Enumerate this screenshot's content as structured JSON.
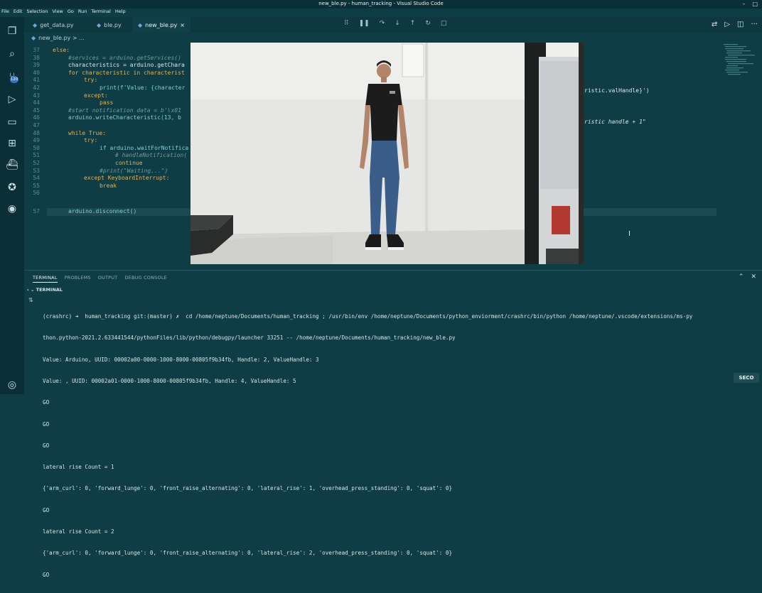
{
  "window": {
    "title": "new_ble.py - human_tracking - Visual Studio Code"
  },
  "menubar": [
    "File",
    "Edit",
    "Selection",
    "View",
    "Go",
    "Run",
    "Terminal",
    "Help"
  ],
  "tabs": [
    {
      "label": "get_data.py",
      "active": false
    },
    {
      "label": "ble.py",
      "active": false
    },
    {
      "label": "new_ble.py",
      "active": true,
      "close": "×"
    }
  ],
  "breadcrumb": "new_ble.py > ...",
  "activity": {
    "badge": "120"
  },
  "editor": {
    "lines": [
      {
        "n": "37",
        "text": "else:"
      },
      {
        "n": "38",
        "text": "#services = arduino.getServices()"
      },
      {
        "n": "39",
        "text": "characteristics = arduino.getChara"
      },
      {
        "n": "40",
        "text": "for characteristic in characterist"
      },
      {
        "n": "41",
        "text": "try:"
      },
      {
        "n": "42",
        "text": "print(f'Value: {character"
      },
      {
        "n": "43",
        "text": "except:"
      },
      {
        "n": "44",
        "text": "pass"
      },
      {
        "n": "45",
        "text": "#start notification data = b'\\x01"
      },
      {
        "n": "46",
        "text": "arduino.writeCharacteristic(13, b"
      },
      {
        "n": "47",
        "text": ""
      },
      {
        "n": "48",
        "text": "while True:"
      },
      {
        "n": "49",
        "text": "try:"
      },
      {
        "n": "50",
        "text": "if arduino.waitForNotifica"
      },
      {
        "n": "51",
        "text": "# handleNotification("
      },
      {
        "n": "52",
        "text": "continue"
      },
      {
        "n": "53",
        "text": "#print(\"Waiting...\")"
      },
      {
        "n": "54",
        "text": "except KeyboardInterrupt:"
      },
      {
        "n": "55",
        "text": "break"
      },
      {
        "n": "56",
        "text": ""
      },
      {
        "n": "57",
        "text": "arduino.disconnect()"
      }
    ],
    "right_fragments": {
      "line42": "ristic.valHandle}')",
      "line46": "ristic handle + 1\""
    }
  },
  "panel": {
    "tabs": [
      "TERMINAL",
      "PROBLEMS",
      "OUTPUT",
      "DEBUG CONSOLE"
    ],
    "section": "TERMINAL",
    "terminal_lines": [
      "(crashrc) ➜  human_tracking git:(master) ✗  cd /home/neptune/Documents/human_tracking ; /usr/bin/env /home/neptune/Documents/python_enviorment/crashrc/bin/python /home/neptune/.vscode/extensions/ms-py",
      "thon.python-2021.2.633441544/pythonFiles/lib/python/debugpy/launcher 33251 -- /home/neptune/Documents/human_tracking/new_ble.py",
      "Value: Arduino, UUID: 00002a00-0000-1000-8000-00805f9b34fb, Handle: 2, ValueHandle: 3",
      "Value: , UUID: 00002a01-0000-1000-8000-00805f9b34fb, Handle: 4, ValueHandle: 5",
      "GO",
      "GO",
      "GO",
      "lateral rise Count = 1",
      "{'arm_curl': 0, 'forward_lunge': 0, 'front_raise_alternating': 0, 'lateral_rise': 1, 'overhead_press_standing': 0, 'squat': 0}",
      "GO",
      "lateral rise Count = 2",
      "{'arm_curl': 0, 'forward_lunge': 0, 'front_raise_alternating': 0, 'lateral_rise': 2, 'overhead_press_standing': 0, 'squat': 0}",
      "GO"
    ]
  },
  "logo": "SECO"
}
